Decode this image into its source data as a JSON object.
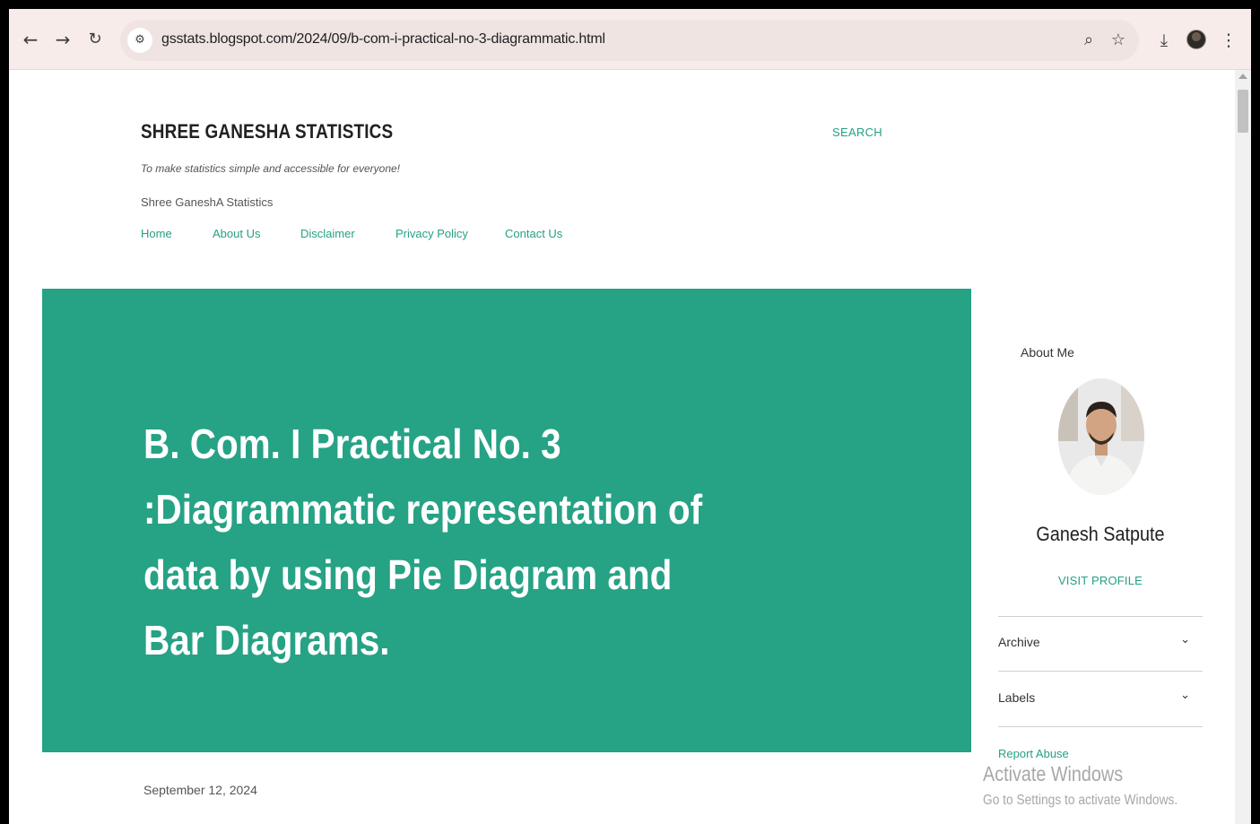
{
  "browser": {
    "url": "gsstats.blogspot.com/2024/09/b-com-i-practical-no-3-diagrammatic.html",
    "icons": [
      "back-arrow-icon",
      "forward-arrow-icon",
      "reload-icon",
      "site-info-icon",
      "zoom-icon",
      "bookmark-star-icon",
      "download-icon",
      "profile-avatar-icon",
      "kebab-menu-icon"
    ]
  },
  "header": {
    "blog_title": "SHREE GANESHA STATISTICS",
    "search_label": "SEARCH",
    "tagline": "To make statistics simple and accessible for everyone!",
    "brand": "Shree GaneshA Statistics"
  },
  "nav": {
    "items": [
      {
        "label": "Home"
      },
      {
        "label": "About Us"
      },
      {
        "label": "Disclaimer"
      },
      {
        "label": "Privacy Policy"
      },
      {
        "label": "Contact Us"
      }
    ]
  },
  "post": {
    "title": "B. Com. I Practical No. 3 :Diagrammatic representation of data by using Pie Diagram and Bar Diagrams.",
    "date": "September 12, 2024"
  },
  "sidebar": {
    "about_heading": "About Me",
    "profile_name": "Ganesh Satpute",
    "visit_profile": "VISIT PROFILE",
    "archive_label": "Archive",
    "labels_label": "Labels",
    "report_abuse": "Report Abuse"
  },
  "overlay": {
    "activate_title": "Activate Windows",
    "activate_sub": "Go to Settings to activate Windows."
  },
  "colors": {
    "accent": "#26a285",
    "toolbar": "#f7ece9"
  }
}
